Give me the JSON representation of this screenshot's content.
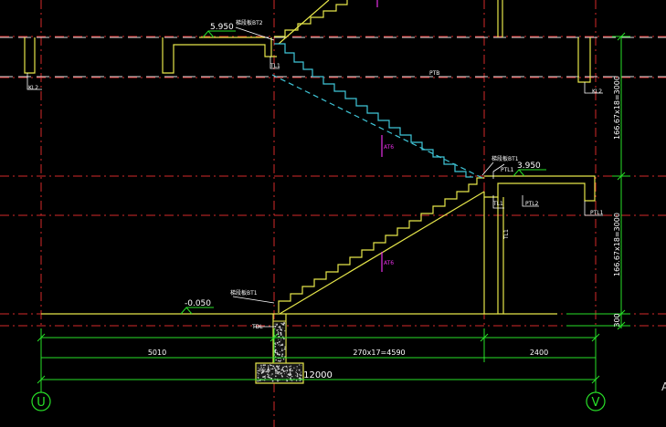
{
  "drawing": {
    "colors": {
      "background": "#000000",
      "axis_red": "#d42a2a",
      "concrete_yellow": "#e6e64a",
      "stair_cyan": "#3fc6d8",
      "dimension_green": "#28e028",
      "annotation_white": "#ffffff",
      "callout_magenta": "#e62ee6",
      "lintel_white": "#dcdcdc"
    },
    "elevations": {
      "top_floor": "5.950",
      "mid_landing": "3.950",
      "ground": "-0.050"
    },
    "labels": {
      "stair_upper_run_title": "梯段板BT2",
      "stair_mid_title": "梯段板BT1",
      "stair_lower_run_title": "梯段板BT1",
      "beam_tl1_upper": "TL1",
      "beam_tl1_mid": "TL1",
      "beam_tl1_low": "TL1",
      "beam_ptl1": "PTL1",
      "beam_ptl2": "PTL2",
      "beam_ptl1_right": "PTL1",
      "beam_tdl": "TDL",
      "slab_pt": "PTB",
      "slab_mid": "PTB",
      "left_beam_tag": "KL2",
      "right_beam_tag": "KL2",
      "atb_upper": "AT6",
      "atb_lower": "AT6"
    },
    "dimensions": {
      "bottom_left": "5010",
      "bottom_mid": "270x17=4590",
      "bottom_right": "2400",
      "overall": "12000",
      "right_upper": "166.67x18=3000",
      "right_lower": "166.67x18=3000",
      "right_base": "300"
    },
    "axes": {
      "left": "U",
      "right": "V"
    },
    "corner_mark": "A"
  }
}
